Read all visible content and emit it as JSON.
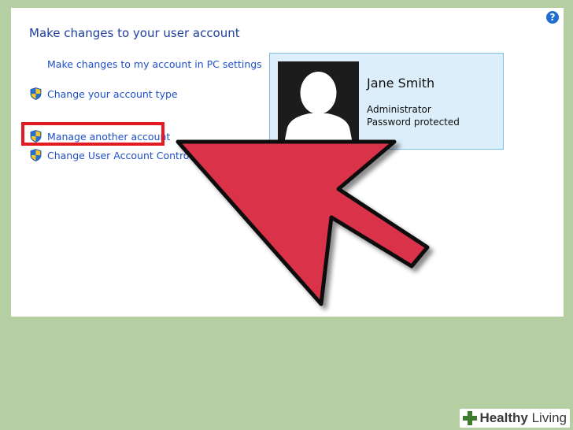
{
  "window": {
    "title": "Make changes to your user account",
    "help_icon": "?"
  },
  "tasks": [
    {
      "label": "Make changes to my account in PC settings",
      "icon": "none"
    },
    {
      "label": "Change your account type",
      "icon": "uac-shield-icon"
    },
    {
      "label": "Manage another account",
      "icon": "uac-shield-icon",
      "highlighted": true
    },
    {
      "label": "Change User Account Control settings",
      "icon": "uac-shield-icon"
    }
  ],
  "account": {
    "name": "Jane Smith",
    "role": "Administrator",
    "status": "Password protected"
  },
  "annotation": {
    "highlight_color": "#e21b22",
    "arrow_color": "#d9304a"
  },
  "watermark": {
    "bold": "Healthy",
    "rest": " Living"
  }
}
